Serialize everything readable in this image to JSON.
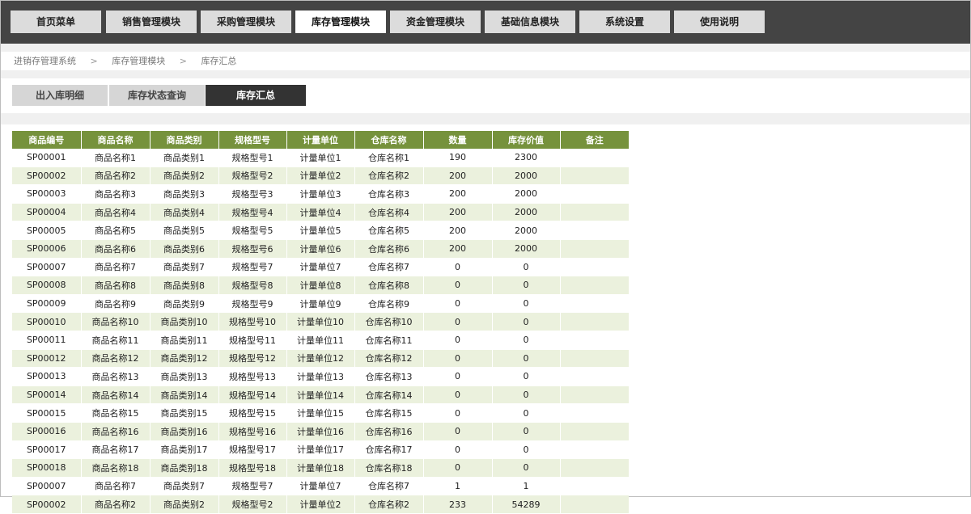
{
  "nav": {
    "items": [
      {
        "label": "首页菜单",
        "active": false
      },
      {
        "label": "销售管理模块",
        "active": false
      },
      {
        "label": "采购管理模块",
        "active": false
      },
      {
        "label": "库存管理模块",
        "active": true
      },
      {
        "label": "资金管理模块",
        "active": false
      },
      {
        "label": "基础信息模块",
        "active": false
      },
      {
        "label": "系统设置",
        "active": false
      },
      {
        "label": "使用说明",
        "active": false
      }
    ]
  },
  "breadcrumb": {
    "items": [
      "进销存管理系统",
      "库存管理模块",
      "库存汇总"
    ],
    "separator": ">"
  },
  "subtabs": [
    {
      "label": "出入库明细",
      "active": false
    },
    {
      "label": "库存状态查询",
      "active": false
    },
    {
      "label": "库存汇总",
      "active": true
    }
  ],
  "table": {
    "headers": [
      "商品编号",
      "商品名称",
      "商品类别",
      "规格型号",
      "计量单位",
      "仓库名称",
      "数量",
      "库存价值",
      "备注"
    ],
    "rows": [
      [
        "SP00001",
        "商品名称1",
        "商品类别1",
        "规格型号1",
        "计量单位1",
        "仓库名称1",
        "190",
        "2300",
        ""
      ],
      [
        "SP00002",
        "商品名称2",
        "商品类别2",
        "规格型号2",
        "计量单位2",
        "仓库名称2",
        "200",
        "2000",
        ""
      ],
      [
        "SP00003",
        "商品名称3",
        "商品类别3",
        "规格型号3",
        "计量单位3",
        "仓库名称3",
        "200",
        "2000",
        ""
      ],
      [
        "SP00004",
        "商品名称4",
        "商品类别4",
        "规格型号4",
        "计量单位4",
        "仓库名称4",
        "200",
        "2000",
        ""
      ],
      [
        "SP00005",
        "商品名称5",
        "商品类别5",
        "规格型号5",
        "计量单位5",
        "仓库名称5",
        "200",
        "2000",
        ""
      ],
      [
        "SP00006",
        "商品名称6",
        "商品类别6",
        "规格型号6",
        "计量单位6",
        "仓库名称6",
        "200",
        "2000",
        ""
      ],
      [
        "SP00007",
        "商品名称7",
        "商品类别7",
        "规格型号7",
        "计量单位7",
        "仓库名称7",
        "0",
        "0",
        ""
      ],
      [
        "SP00008",
        "商品名称8",
        "商品类别8",
        "规格型号8",
        "计量单位8",
        "仓库名称8",
        "0",
        "0",
        ""
      ],
      [
        "SP00009",
        "商品名称9",
        "商品类别9",
        "规格型号9",
        "计量单位9",
        "仓库名称9",
        "0",
        "0",
        ""
      ],
      [
        "SP00010",
        "商品名称10",
        "商品类别10",
        "规格型号10",
        "计量单位10",
        "仓库名称10",
        "0",
        "0",
        ""
      ],
      [
        "SP00011",
        "商品名称11",
        "商品类别11",
        "规格型号11",
        "计量单位11",
        "仓库名称11",
        "0",
        "0",
        ""
      ],
      [
        "SP00012",
        "商品名称12",
        "商品类别12",
        "规格型号12",
        "计量单位12",
        "仓库名称12",
        "0",
        "0",
        ""
      ],
      [
        "SP00013",
        "商品名称13",
        "商品类别13",
        "规格型号13",
        "计量单位13",
        "仓库名称13",
        "0",
        "0",
        ""
      ],
      [
        "SP00014",
        "商品名称14",
        "商品类别14",
        "规格型号14",
        "计量单位14",
        "仓库名称14",
        "0",
        "0",
        ""
      ],
      [
        "SP00015",
        "商品名称15",
        "商品类别15",
        "规格型号15",
        "计量单位15",
        "仓库名称15",
        "0",
        "0",
        ""
      ],
      [
        "SP00016",
        "商品名称16",
        "商品类别16",
        "规格型号16",
        "计量单位16",
        "仓库名称16",
        "0",
        "0",
        ""
      ],
      [
        "SP00017",
        "商品名称17",
        "商品类别17",
        "规格型号17",
        "计量单位17",
        "仓库名称17",
        "0",
        "0",
        ""
      ],
      [
        "SP00018",
        "商品名称18",
        "商品类别18",
        "规格型号18",
        "计量单位18",
        "仓库名称18",
        "0",
        "0",
        ""
      ],
      [
        "SP00007",
        "商品名称7",
        "商品类别7",
        "规格型号7",
        "计量单位7",
        "仓库名称7",
        "1",
        "1",
        ""
      ],
      [
        "SP00002",
        "商品名称2",
        "商品类别2",
        "规格型号2",
        "计量单位2",
        "仓库名称2",
        "233",
        "54289",
        ""
      ]
    ]
  },
  "colors": {
    "nav_bar": "#444444",
    "nav_item": "#dcdcdc",
    "nav_active": "#ffffff",
    "subtab": "#d6d6d6",
    "subtab_active": "#333333",
    "table_header": "#76923c",
    "table_row_even": "#ebf1dd",
    "table_row_odd": "#ffffff"
  }
}
